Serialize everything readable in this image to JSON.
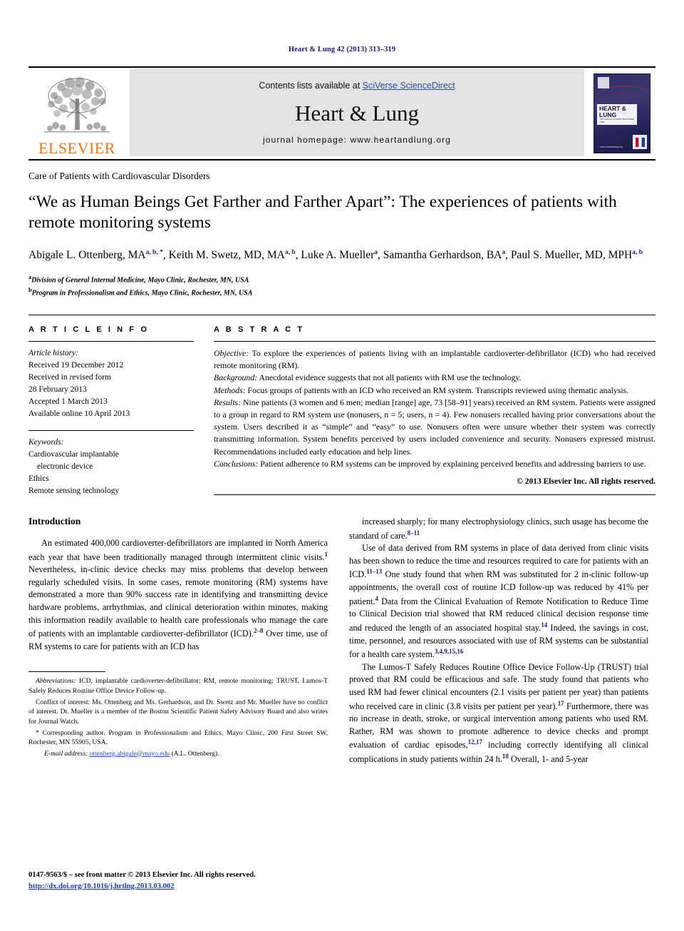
{
  "running_head": "Heart & Lung 42 (2013) 313–319",
  "banner": {
    "publisher_logo_text": "ELSEVIER",
    "publisher_logo_icon": "elsevier-tree-icon",
    "contents_prefix": "Contents lists available at ",
    "contents_link": "SciVerse ScienceDirect",
    "journal_title": "Heart & Lung",
    "homepage": "journal homepage: www.heartandlung.org",
    "cover": {
      "title": "HEART & LUNG",
      "subtitle": "The Journal of Acute and Critical Care",
      "footer": "www.heartandlung.org"
    }
  },
  "section_label": "Care of Patients with Cardiovascular Disorders",
  "title": "“We as Human Beings Get Farther and Farther Apart”: The experiences of patients with remote monitoring systems",
  "authors": [
    {
      "name": "Abigale L. Ottenberg, MA",
      "sup": "a, b, *"
    },
    {
      "name": "Keith M. Swetz, MD, MA",
      "sup": "a, b"
    },
    {
      "name": "Luke A. Mueller",
      "sup": "a"
    },
    {
      "name": "Samantha Gerhardson, BA",
      "sup": "a"
    },
    {
      "name": "Paul S. Mueller, MD, MPH",
      "sup": "a, b"
    }
  ],
  "affiliations": [
    {
      "mark": "a",
      "text": "Division of General Internal Medicine, Mayo Clinic, Rochester, MN, USA"
    },
    {
      "mark": "b",
      "text": "Program in Professionalism and Ethics, Mayo Clinic, Rochester, MN, USA"
    }
  ],
  "article_info": {
    "heading": "A R T I C L E  I N F O",
    "history_label": "Article history:",
    "history": [
      "Received 19 December 2012",
      "Received in revised form",
      "28 February 2013",
      "Accepted 1 March 2013",
      "Available online 10 April 2013"
    ],
    "keywords_label": "Keywords:",
    "keywords": [
      "Cardiovascular implantable",
      "electronic device",
      "Ethics",
      "Remote sensing technology"
    ]
  },
  "abstract": {
    "heading": "A B S T R A C T",
    "sections": [
      {
        "label": "Objective:",
        "text": " To explore the experiences of patients living with an implantable cardioverter-defibrillator (ICD) who had received remote monitoring (RM)."
      },
      {
        "label": "Background:",
        "text": " Anecdotal evidence suggests that not all patients with RM use the technology."
      },
      {
        "label": "Methods:",
        "text": " Focus groups of patients with an ICD who received an RM system. Transcripts reviewed using thematic analysis."
      },
      {
        "label": "Results:",
        "text": " Nine patients (3 women and 6 men; median [range] age, 73 [58–91] years) received an RM system. Patients were assigned to a group in regard to RM system use (nonusers, n = 5; users, n = 4). Few nonusers recalled having prior conversations about the system. Users described it as “simple” and “easy” to use. Nonusers often were unsure whether their system was correctly transmitting information. System benefits perceived by users included convenience and security. Nonusers expressed mistrust. Recommendations included early education and help lines."
      },
      {
        "label": "Conclusions:",
        "text": " Patient adherence to RM systems can be improved by explaining perceived benefits and addressing barriers to use."
      }
    ],
    "copyright": "© 2013 Elsevier Inc. All rights reserved."
  },
  "body": {
    "heading": "Introduction",
    "left_paragraphs": [
      "An estimated 400,000 cardioverter-defibrillators are implanted in North America each year that have been traditionally managed through intermittent clinic visits.|1| Nevertheless, in-clinic device checks may miss problems that develop between regularly scheduled visits. In some cases, remote monitoring (RM) systems have demonstrated a more than 90% success rate in identifying and transmitting device hardware problems, arrhythmias, and clinical deterioration within minutes, making this information readily available to health care professionals who manage the care of patients with an implantable cardioverter-defibrillator (ICD).|2–8| Over time, use of RM systems to care for patients with an ICD has"
    ],
    "right_paragraphs": [
      "increased sharply; for many electrophysiology clinics, such usage has become the standard of care.|8–11|",
      "Use of data derived from RM systems in place of data derived from clinic visits has been shown to reduce the time and resources required to care for patients with an ICD.|11–13| One study found that when RM was substituted for 2 in-clinic follow-up appointments, the overall cost of routine ICD follow-up was reduced by 41% per patient.|4| Data from the Clinical Evaluation of Remote Notification to Reduce Time to Clinical Decision trial showed that RM reduced clinical decision response time and reduced the length of an associated hospital stay.|14| Indeed, the savings in cost, time, personnel, and resources associated with use of RM systems can be substantial for a health care system.|3,4,9,15,16|",
      "The Lumos-T Safely Reduces Routine Office Device Follow-Up (TRUST) trial proved that RM could be efficacious and safe. The study found that patients who used RM had fewer clinical encounters (2.1 visits per patient per year) than patients who received care in clinic (3.8 visits per patient per year).|17| Furthermore, there was no increase in death, stroke, or surgical intervention among patients who used RM. Rather, RM was shown to promote adherence to device checks and prompt evaluation of cardiac episodes,|12,17| including correctly identifying all clinical complications in study patients within 24 h.|18| Overall, 1- and 5-year"
    ]
  },
  "footnotes": [
    {
      "label": "Abbreviations:",
      "text": " ICD, implantable cardioverter-defibrillator; RM, remote monitoring; TRUST, Lumos-T Safely Reduces Routine Office Device Follow-up."
    },
    {
      "label": "",
      "text": "Conflict of interest: Ms. Ottenberg and Ms. Gerhardson, and Dr. Swetz and Mr. Mueller have no conflict of interest. Dr. Mueller is a member of the Boston Scientific Patient Safety Advisory Board and also writes for Journal Watch."
    },
    {
      "label": "",
      "text": "* Corresponding author. Program in Professionalism and Ethics, Mayo Clinic, 200 First Street SW, Rochester, MN 55905, USA."
    }
  ],
  "email_footnote": {
    "label": "E-mail address:",
    "email": "ottenberg.abigale@mayo.edu",
    "suffix": " (A.L. Ottenberg)."
  },
  "page_footer": {
    "issn_line": "0147-9563/$ – see front matter © 2013 Elsevier Inc. All rights reserved.",
    "doi": "http://dx.doi.org/10.1016/j.hrtlng.2013.03.002"
  },
  "colors": {
    "link_blue": "#2b4ea2",
    "running_head_navy": "#1a1a6e",
    "elsevier_orange": "#E87722",
    "banner_grey": "#e3e3e3"
  }
}
